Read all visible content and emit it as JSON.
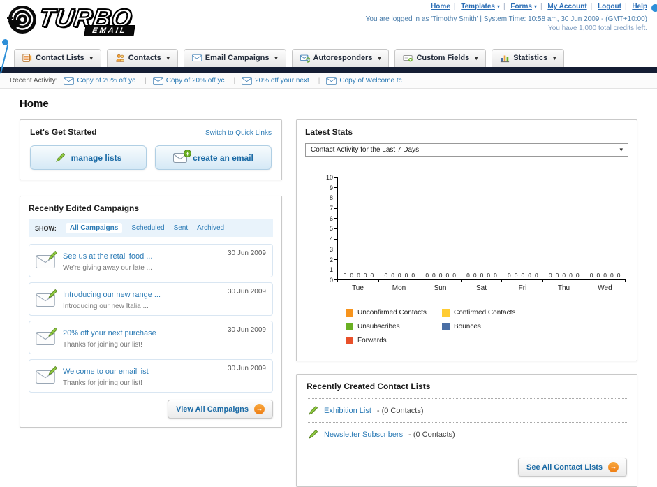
{
  "header": {
    "logo_title": "TURBO",
    "logo_subtitle": "EMAIL",
    "links": [
      {
        "label": "Home",
        "has_arrow": false
      },
      {
        "label": "Templates",
        "has_arrow": true
      },
      {
        "label": "Forms",
        "has_arrow": true
      },
      {
        "label": "My Account",
        "has_arrow": false
      },
      {
        "label": "Logout",
        "has_arrow": false
      },
      {
        "label": "Help",
        "has_arrow": false
      }
    ],
    "login_info": "You are logged in as 'Timothy Smith' | System Time: 10:58 am, 30 Jun 2009 - (GMT+10:00)",
    "credits_info": "You have 1,000 total credits left."
  },
  "nav": {
    "tabs": [
      {
        "label": "Contact Lists"
      },
      {
        "label": "Contacts"
      },
      {
        "label": "Email Campaigns"
      },
      {
        "label": "Autoresponders"
      },
      {
        "label": "Custom Fields"
      },
      {
        "label": "Statistics"
      }
    ]
  },
  "activity": {
    "label": "Recent Activity:",
    "items": [
      "Copy of 20% off yc",
      "Copy of 20% off yc",
      "20% off your next",
      "Copy of Welcome tc"
    ]
  },
  "page": {
    "title": "Home"
  },
  "get_started": {
    "title": "Let's Get Started",
    "switch_link": "Switch to Quick Links",
    "manage_label": "manage lists",
    "create_label": "create an email"
  },
  "campaigns": {
    "title": "Recently Edited Campaigns",
    "show_label": "SHOW:",
    "filters": [
      "All Campaigns",
      "Scheduled",
      "Sent",
      "Archived"
    ],
    "active_filter": "All Campaigns",
    "items": [
      {
        "title": "See us at the retail food ...",
        "subtitle": "We're giving away our late ...",
        "date": "30 Jun 2009"
      },
      {
        "title": "Introducing our new range ...",
        "subtitle": "Introducing our new Italia ...",
        "date": "30 Jun 2009"
      },
      {
        "title": "20% off your next purchase",
        "subtitle": "Thanks for joining our list!",
        "date": "30 Jun 2009"
      },
      {
        "title": "Welcome to our email list",
        "subtitle": "Thanks for joining our list!",
        "date": "30 Jun 2009"
      }
    ],
    "view_all": "View All Campaigns"
  },
  "stats": {
    "title": "Latest Stats",
    "period": "Contact Activity for the Last 7 Days",
    "chart_data": {
      "type": "bar",
      "title": "Contact Activity for the Last 7 Days",
      "categories": [
        "Tue",
        "Mon",
        "Sun",
        "Sat",
        "Fri",
        "Thu",
        "Wed"
      ],
      "series": [
        {
          "name": "Unconfirmed Contacts",
          "color": "#f7941d",
          "values": [
            0,
            0,
            0,
            0,
            0,
            0,
            0
          ]
        },
        {
          "name": "Confirmed Contacts",
          "color": "#ffcc33",
          "values": [
            0,
            0,
            0,
            0,
            0,
            0,
            0
          ]
        },
        {
          "name": "Unsubscribes",
          "color": "#6ab023",
          "values": [
            0,
            0,
            0,
            0,
            0,
            0,
            0
          ]
        },
        {
          "name": "Bounces",
          "color": "#4a6fa5",
          "values": [
            0,
            0,
            0,
            0,
            0,
            0,
            0
          ]
        },
        {
          "name": "Forwards",
          "color": "#e8502a",
          "values": [
            0,
            0,
            0,
            0,
            0,
            0,
            0
          ]
        }
      ],
      "ylim": [
        0,
        10
      ],
      "yticks": [
        0,
        1,
        2,
        3,
        4,
        5,
        6,
        7,
        8,
        9,
        10
      ],
      "grid": false,
      "legend_position": "bottom"
    }
  },
  "lists": {
    "title": "Recently Created Contact Lists",
    "items": [
      {
        "name": "Exhibition List",
        "suffix": "- (0 Contacts)"
      },
      {
        "name": "Newsletter Subscribers",
        "suffix": "- (0 Contacts)"
      }
    ],
    "see_all": "See All Contact Lists"
  },
  "icons": {
    "dropdown_arrow": "▾",
    "arrow_right": "→",
    "plus": "+"
  }
}
